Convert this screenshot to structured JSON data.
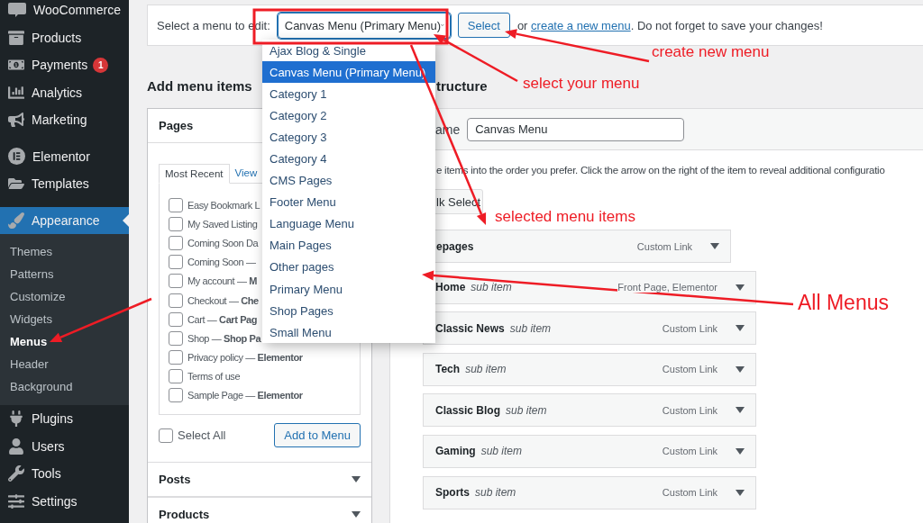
{
  "sidebar": {
    "groups": [
      [
        {
          "label": "WooCommerce",
          "selected": false
        },
        {
          "label": "Products",
          "selected": false
        },
        {
          "label": "Payments",
          "selected": false,
          "badge": "1"
        },
        {
          "label": "Analytics",
          "selected": false
        },
        {
          "label": "Marketing",
          "selected": false
        }
      ],
      [
        {
          "label": "Elementor",
          "selected": false
        },
        {
          "label": "Templates",
          "selected": false
        }
      ],
      [
        {
          "label": "Appearance",
          "selected": true,
          "children": [
            {
              "label": "Themes",
              "selected": false
            },
            {
              "label": "Patterns",
              "selected": false
            },
            {
              "label": "Customize",
              "selected": false
            },
            {
              "label": "Widgets",
              "selected": false
            },
            {
              "label": "Menus",
              "selected": true
            },
            {
              "label": "Header",
              "selected": false
            },
            {
              "label": "Background",
              "selected": false
            }
          ]
        },
        {
          "label": "Plugins",
          "selected": false
        },
        {
          "label": "Users",
          "selected": false
        },
        {
          "label": "Tools",
          "selected": false
        },
        {
          "label": "Settings",
          "selected": false
        }
      ]
    ]
  },
  "toolbar": {
    "label": "Select a menu to edit:",
    "menu_select": {
      "value": "Canvas Menu (Primary Menu)",
      "expanded": true
    },
    "select_button": "Select",
    "hint_before": "or",
    "hint_link": "create a new menu",
    "hint_after": ". Do not forget to save your changes!"
  },
  "dropdown": {
    "options": [
      {
        "label": "Ajax Blog & Single",
        "selected": false
      },
      {
        "label": "Canvas Menu (Primary Menu)",
        "selected": true
      },
      {
        "label": "Category 1",
        "selected": false
      },
      {
        "label": "Category 2",
        "selected": false
      },
      {
        "label": "Category 3",
        "selected": false
      },
      {
        "label": "Category 4",
        "selected": false
      },
      {
        "label": "CMS Pages",
        "selected": false
      },
      {
        "label": "Footer Menu",
        "selected": false
      },
      {
        "label": "Language Menu",
        "selected": false
      },
      {
        "label": "Main Pages",
        "selected": false
      },
      {
        "label": "Other pages",
        "selected": false
      },
      {
        "label": "Primary Menu",
        "selected": false
      },
      {
        "label": "Shop Pages",
        "selected": false
      },
      {
        "label": "Small Menu",
        "selected": false
      }
    ]
  },
  "add_items": {
    "heading": "Add menu items",
    "sections": [
      {
        "title": "Pages",
        "expanded": true
      },
      {
        "title": "Posts",
        "expanded": false
      },
      {
        "title": "Products",
        "expanded": false
      }
    ],
    "tabs": [
      {
        "label": "Most Recent",
        "selected": true
      },
      {
        "label": "View",
        "selected": false
      }
    ],
    "pages": [
      {
        "label": "Easy Bookmark L",
        "checked": false
      },
      {
        "label": "My Saved Listing",
        "checked": false
      },
      {
        "label": "Coming Soon Da",
        "checked": false
      },
      {
        "label": "Coming Soon —",
        "checked": false
      },
      {
        "label": "My account — **M**",
        "checked": false
      },
      {
        "label": "Checkout — **Che**",
        "checked": false
      },
      {
        "label": "Cart — **Cart Pag**",
        "checked": false
      },
      {
        "label": "Shop — **Shop Pa**",
        "checked": false
      },
      {
        "label": "Privacy policy — **Elementor**",
        "checked": false
      },
      {
        "label": "Terms of use",
        "checked": false
      },
      {
        "label": "Sample Page — **Elementor**",
        "checked": false
      }
    ],
    "select_all": {
      "label": "Select All",
      "checked": false
    },
    "add_button": "Add to Menu"
  },
  "structure": {
    "heading": "tructure",
    "name_label": "ame",
    "name_value": "Canvas Menu",
    "instructions": "e items into the order you prefer. Click the arrow on the right of the item to reveal additional configuratio",
    "bulk_select": "lk Select",
    "items": [
      {
        "kind": "top",
        "title": "epages",
        "type": "Custom Link"
      },
      {
        "kind": "sub",
        "title": "Home",
        "subtitle": "sub item",
        "type": "Front Page, Elementor"
      },
      {
        "kind": "sub",
        "title": "Classic News",
        "subtitle": "sub item",
        "type": "Custom Link"
      },
      {
        "kind": "sub",
        "title": "Tech",
        "subtitle": "sub item",
        "type": "Custom Link"
      },
      {
        "kind": "sub",
        "title": "Classic Blog",
        "subtitle": "sub item",
        "type": "Custom Link"
      },
      {
        "kind": "sub",
        "title": "Gaming",
        "subtitle": "sub item",
        "type": "Custom Link"
      },
      {
        "kind": "sub",
        "title": "Sports",
        "subtitle": "sub item",
        "type": "Custom Link"
      }
    ]
  },
  "annotations": [
    {
      "text": "create new menu"
    },
    {
      "text": "select your menu"
    },
    {
      "text": "selected menu items"
    },
    {
      "text": "All Menus"
    }
  ]
}
